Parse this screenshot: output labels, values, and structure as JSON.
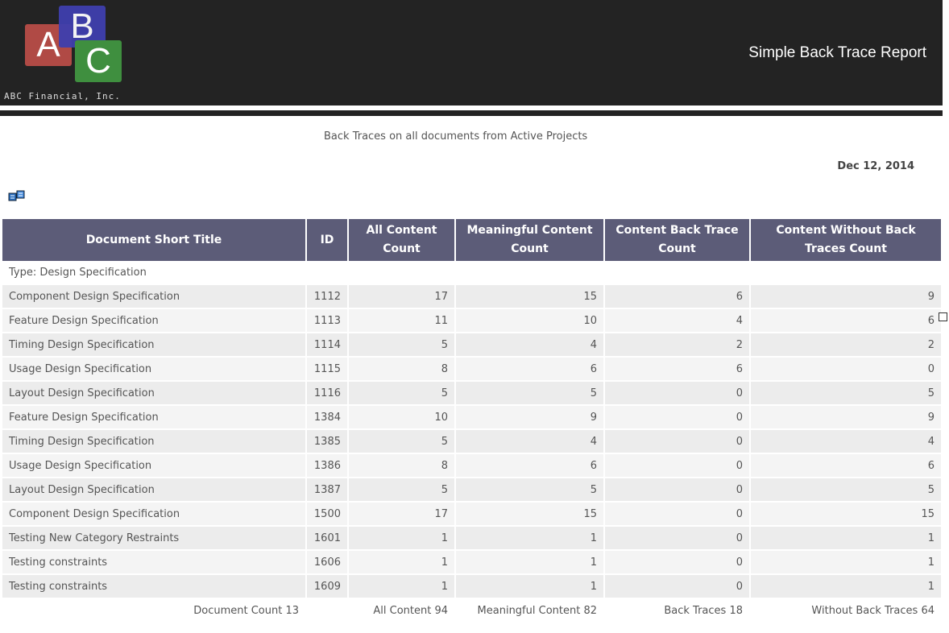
{
  "header": {
    "logo_letters": [
      "A",
      "B",
      "C"
    ],
    "company": "ABC Financial, Inc.",
    "report_title": "Simple Back Trace Report"
  },
  "subtitle": "Back Traces on all documents from Active Projects",
  "date": "Dec 12, 2014",
  "colors": {
    "header_bg": "#232323",
    "table_header": "#5c5c78",
    "block_a": "#b04a45",
    "block_b": "#3f3fae",
    "block_c": "#3f8f3f"
  },
  "table": {
    "columns": [
      "Document Short Title",
      "ID",
      "All Content Count",
      "Meaningful Content Count",
      "Content Back Trace Count",
      "Content Without Back Traces Count"
    ],
    "group": "Type: Design Specification",
    "rows": [
      [
        "Component Design Specification",
        "1112",
        "17",
        "15",
        "6",
        "9"
      ],
      [
        "Feature Design Specification",
        "1113",
        "11",
        "10",
        "4",
        "6"
      ],
      [
        "Timing Design Specification",
        "1114",
        "5",
        "4",
        "2",
        "2"
      ],
      [
        "Usage Design Specification",
        "1115",
        "8",
        "6",
        "6",
        "0"
      ],
      [
        "Layout Design Specification",
        "1116",
        "5",
        "5",
        "0",
        "5"
      ],
      [
        "Feature Design Specification",
        "1384",
        "10",
        "9",
        "0",
        "9"
      ],
      [
        "Timing Design Specification",
        "1385",
        "5",
        "4",
        "0",
        "4"
      ],
      [
        "Usage Design Specification",
        "1386",
        "8",
        "6",
        "0",
        "6"
      ],
      [
        "Layout Design Specification",
        "1387",
        "5",
        "5",
        "0",
        "5"
      ],
      [
        "Component Design Specification",
        "1500",
        "17",
        "15",
        "0",
        "15"
      ],
      [
        "Testing New Category Restraints",
        "1601",
        "1",
        "1",
        "0",
        "1"
      ],
      [
        "Testing constraints",
        "1606",
        "1",
        "1",
        "0",
        "1"
      ],
      [
        "Testing constraints",
        "1609",
        "1",
        "1",
        "0",
        "1"
      ]
    ],
    "footer": {
      "document_count": "Document Count 13",
      "all_content": "All Content 94",
      "meaningful": "Meaningful Content 82",
      "back_traces": "Back Traces 18",
      "without": "Without Back Traces 64"
    }
  }
}
